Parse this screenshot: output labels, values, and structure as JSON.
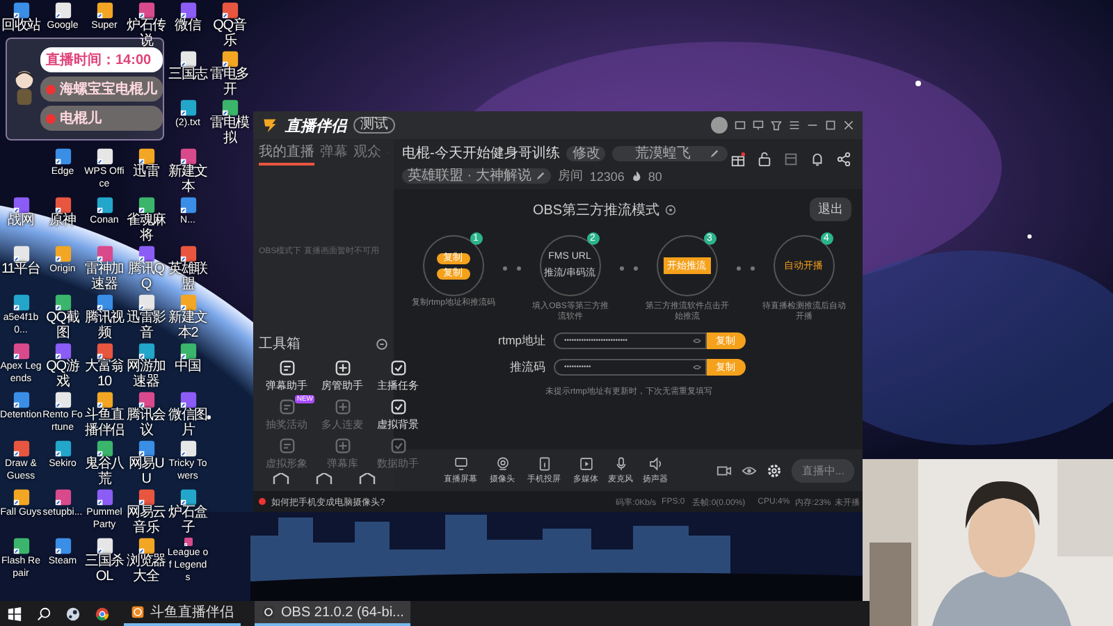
{
  "desktop": {
    "columns": [
      [
        {
          "label": "回收站"
        },
        {
          "kind": "empty"
        },
        {
          "kind": "empty"
        },
        {
          "kind": "empty"
        },
        {
          "label": "战网"
        },
        {
          "label": "11平台"
        },
        {
          "label": "a5e4f1b0..."
        },
        {
          "label": "Apex Legends"
        },
        {
          "label": "Detention"
        },
        {
          "label": "Draw & Guess"
        },
        {
          "label": "Fall Guys"
        },
        {
          "label": "Flash Repair"
        }
      ],
      [
        {
          "label": "Google"
        },
        {
          "kind": "empty"
        },
        {
          "kind": "empty"
        },
        {
          "label": "Edge"
        },
        {
          "label": "原神"
        },
        {
          "label": "Origin"
        },
        {
          "label": "QQ截图"
        },
        {
          "label": "QQ游戏"
        },
        {
          "label": "Rento Fortune"
        },
        {
          "label": "Sekiro"
        },
        {
          "label": "setupbi..."
        },
        {
          "label": "Steam"
        }
      ],
      [
        {
          "label": "Super"
        },
        {
          "kind": "empty"
        },
        {
          "kind": "empty"
        },
        {
          "label": "WPS Office"
        },
        {
          "label": "Conan"
        },
        {
          "label": "雷神加速器"
        },
        {
          "label": "腾讯视频"
        },
        {
          "label": "大富翁10"
        },
        {
          "label": "斗鱼直播伴侣"
        },
        {
          "label": "鬼谷八荒"
        },
        {
          "label": "Pummel Party"
        },
        {
          "label": "三国杀OL"
        }
      ],
      [
        {
          "label": "炉石传说"
        },
        {
          "kind": "empty"
        },
        {
          "kind": "empty"
        },
        {
          "label": "迅雷"
        },
        {
          "label": "雀魂麻将"
        },
        {
          "label": "腾讯QQ"
        },
        {
          "label": "迅雷影音"
        },
        {
          "label": "网游加速器"
        },
        {
          "label": "腾讯会议"
        },
        {
          "label": "网易UU"
        },
        {
          "label": "网易云音乐"
        },
        {
          "label": "浏览器大全"
        }
      ],
      [
        {
          "label": "微信"
        },
        {
          "label": "三国志"
        },
        {
          "label": "(2).txt"
        },
        {
          "label": "新建文本"
        },
        {
          "label": "N..."
        },
        {
          "label": "英雄联盟"
        },
        {
          "label": "新建文本2"
        },
        {
          "label": "中国"
        },
        {
          "label": "微信图片"
        },
        {
          "label": "Tricky Towers"
        },
        {
          "label": "炉石盒子"
        },
        {
          "label": "League of Legends"
        }
      ],
      [
        {
          "label": "QQ音乐"
        },
        {
          "label": "雷电多开"
        },
        {
          "label": "雷电模拟"
        }
      ]
    ]
  },
  "overlay_widget": {
    "timer": "直播时间：14:00",
    "badges": [
      "海螺宝宝电棍儿",
      "电棍儿"
    ]
  },
  "app_window": {
    "logo": "直播伴侣",
    "version_badge": "测试",
    "tabs": [
      {
        "label": "我的直播",
        "selected": true
      },
      {
        "label": "弹幕",
        "selected": false
      },
      {
        "label": "观众",
        "selected": false
      }
    ],
    "empty_note": "OBS模式下 直播画面暂时不可用",
    "toolbox": {
      "title": "工具箱",
      "tools": [
        {
          "label": "弹幕助手",
          "disabled": false
        },
        {
          "label": "房管助手",
          "disabled": false
        },
        {
          "label": "主播任务",
          "disabled": false
        },
        {
          "label": "抽奖活动",
          "disabled": true,
          "badge": "NEW"
        },
        {
          "label": "多人连麦",
          "disabled": true
        },
        {
          "label": "虚拟背景",
          "disabled": false
        },
        {
          "label": "虚拟形象",
          "disabled": true
        },
        {
          "label": "弹幕库",
          "disabled": true
        },
        {
          "label": "数据助手",
          "disabled": true
        }
      ]
    },
    "room": {
      "title": "电棍-今天开始健身哥训练",
      "edit_button": "修改",
      "category": "荒漠蝗飞",
      "tag": "英雄联盟 · 大神解说",
      "room_label": "房间",
      "room_id": "12306",
      "heat": "80"
    },
    "obs": {
      "title": "OBS第三方推流模式",
      "exit_button": "退出",
      "steps": [
        {
          "number": "1",
          "kind": "copy",
          "buttons": [
            "复制",
            "复制"
          ],
          "caption": "复制rtmp地址和推流码"
        },
        {
          "number": "2",
          "kind": "text",
          "lines": [
            "FMS URL",
            "推流/串码流"
          ],
          "caption": "填入OBS等第三方推流软件"
        },
        {
          "number": "3",
          "kind": "button",
          "buttons": [
            "开始推流"
          ],
          "caption": "第三方推流软件点击开始推流"
        },
        {
          "number": "4",
          "kind": "accent",
          "lines": [
            "自动开播"
          ],
          "caption": "待直播检测推流后自动开播"
        }
      ],
      "fields": [
        {
          "label": "rtmp地址",
          "value": "••••••••••••••••••••••••••",
          "button": "复制"
        },
        {
          "label": "推流码",
          "value": "•••••••••••",
          "button": "复制"
        }
      ],
      "note": "未提示rtmp地址有更新时，下次无需重复填写"
    },
    "toolbar": {
      "items": [
        {
          "label": "直播屏幕",
          "kind": "screen"
        },
        {
          "label": "摄像头",
          "kind": "camera"
        },
        {
          "label": "手机投屏",
          "kind": "phone"
        },
        {
          "label": "多媒体",
          "kind": "media"
        },
        {
          "label": "麦克风",
          "kind": "mic"
        },
        {
          "label": "扬声器",
          "kind": "speaker"
        }
      ],
      "live_button": "直播中..."
    },
    "status": {
      "tip": "如何把手机变成电脑摄像头?",
      "stats": [
        "码率:0Kb/s",
        "FPS:0",
        "丢帧:0(0.00%)",
        "CPU:4%",
        "内存:23%"
      ],
      "state": "未开播"
    }
  },
  "taskbar": {
    "apps": [
      {
        "label": "斗鱼直播伴侣",
        "selected": false
      },
      {
        "label": "OBS 21.0.2 (64-bi...",
        "selected": true
      }
    ]
  }
}
